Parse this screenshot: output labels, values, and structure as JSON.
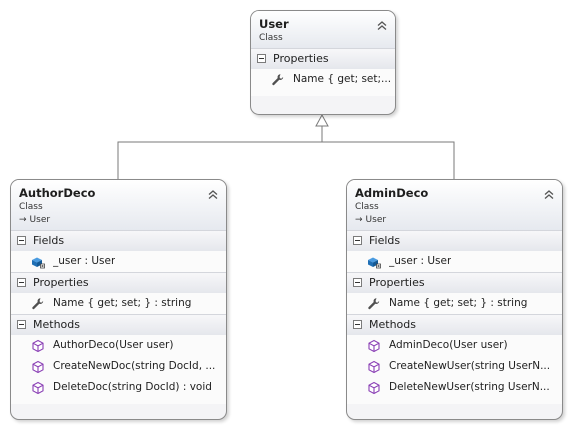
{
  "classes": [
    {
      "name": "User",
      "kind": "Class",
      "base": "",
      "compartments": [
        {
          "title": "Properties",
          "members": [
            {
              "icon": "wrench-icon",
              "text": "Name { get; set;..."
            }
          ]
        }
      ]
    },
    {
      "name": "AuthorDeco",
      "kind": "Class",
      "base": "User",
      "compartments": [
        {
          "title": "Fields",
          "members": [
            {
              "icon": "field-icon",
              "text": "_user : User"
            }
          ]
        },
        {
          "title": "Properties",
          "members": [
            {
              "icon": "wrench-icon",
              "text": "Name { get; set; } : string"
            }
          ]
        },
        {
          "title": "Methods",
          "members": [
            {
              "icon": "method-icon",
              "text": "AuthorDeco(User user)"
            },
            {
              "icon": "method-icon",
              "text": "CreateNewDoc(string  DocId, ..."
            },
            {
              "icon": "method-icon",
              "text": "DeleteDoc(string DocId) : void"
            }
          ]
        }
      ]
    },
    {
      "name": "AdminDeco",
      "kind": "Class",
      "base": "User",
      "compartments": [
        {
          "title": "Fields",
          "members": [
            {
              "icon": "field-icon",
              "text": "_user : User"
            }
          ]
        },
        {
          "title": "Properties",
          "members": [
            {
              "icon": "wrench-icon",
              "text": "Name { get; set; } : string"
            }
          ]
        },
        {
          "title": "Methods",
          "members": [
            {
              "icon": "method-icon",
              "text": "AdminDeco(User user)"
            },
            {
              "icon": "method-icon",
              "text": "CreateNewUser(string  UserN..."
            },
            {
              "icon": "method-icon",
              "text": "DeleteNewUser(string  UserN..."
            }
          ]
        }
      ]
    }
  ],
  "colors": {
    "connector": "#7a7a7a",
    "method_icon": "#8a3fb5",
    "field_icon": "#1f6fb5",
    "wrench_icon": "#505050"
  }
}
